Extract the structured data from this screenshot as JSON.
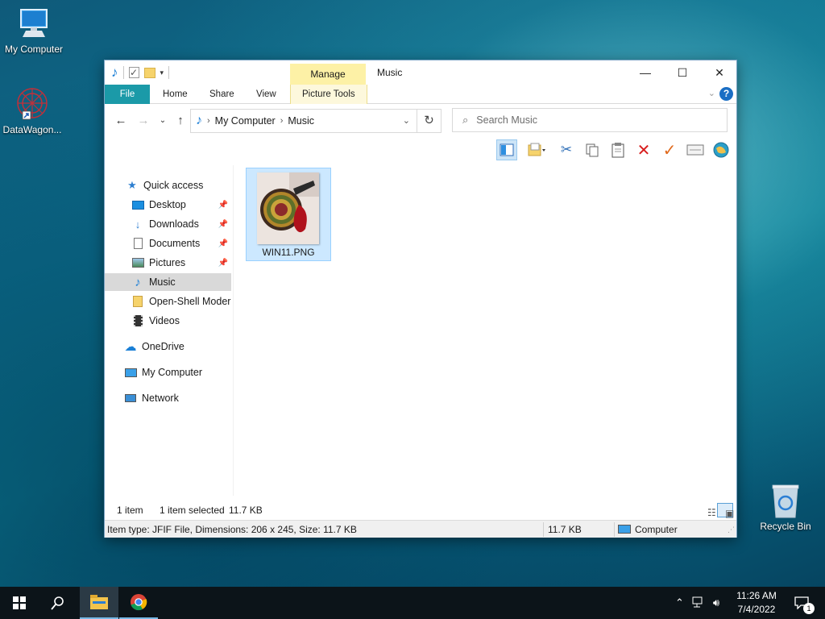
{
  "desktop": {
    "icons": [
      {
        "label": "My Computer"
      },
      {
        "label": "DataWagon..."
      },
      {
        "label": "Recycle Bin"
      }
    ]
  },
  "window": {
    "title": "Music",
    "context_tab_group": "Manage",
    "ribbon_tabs": [
      "File",
      "Home",
      "Share",
      "View",
      "Picture Tools"
    ],
    "controls": {
      "minimize": "—",
      "maximize": "☐",
      "close": "✕"
    },
    "help": "?"
  },
  "address": {
    "crumbs": [
      "My Computer",
      "Music"
    ]
  },
  "search": {
    "placeholder": "Search Music"
  },
  "nav_pane": {
    "quick_access": "Quick access",
    "items": [
      {
        "label": "Desktop",
        "pinned": true
      },
      {
        "label": "Downloads",
        "pinned": true
      },
      {
        "label": "Documents",
        "pinned": true
      },
      {
        "label": "Pictures",
        "pinned": true
      },
      {
        "label": "Music",
        "selected": true
      },
      {
        "label": "Open-Shell Modern"
      },
      {
        "label": "Videos"
      }
    ],
    "onedrive": "OneDrive",
    "my_computer": "My Computer",
    "network": "Network"
  },
  "files": [
    {
      "name": "WIN11.PNG",
      "selected": true
    }
  ],
  "status": {
    "item_count": "1 item",
    "selection": "1 item selected",
    "selection_size": "11.7 KB"
  },
  "details": {
    "info": "Item type: JFIF File, Dimensions: 206 x 245, Size: 11.7 KB",
    "size": "11.7 KB",
    "location": "Computer"
  },
  "taskbar": {
    "time": "11:26 AM",
    "date": "7/4/2022",
    "notification_count": "1"
  },
  "colors": {
    "file_tab": "#1b9aa8",
    "manage_tab": "#fdf1a6",
    "selection": "#cce8ff",
    "accent": "#1a6ec4"
  }
}
